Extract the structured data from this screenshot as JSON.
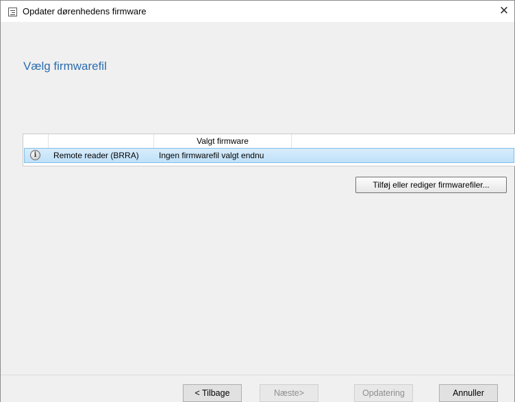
{
  "window": {
    "title": "Opdater dørenhedens firmware",
    "close_symbol": "✕"
  },
  "heading": "Vælg firmwarefil",
  "list": {
    "columns": [
      "",
      "",
      "Valgt firmware",
      ""
    ],
    "rows": [
      {
        "icon": "info-icon",
        "icon_glyph": "i",
        "device": "Remote reader (BRRA)",
        "firmware": "Ingen firmwarefil valgt endnu",
        "selected": true
      }
    ]
  },
  "add_edit_button": "Tilføj eller rediger firmwarefiler...",
  "footer": {
    "back": "< Tilbage",
    "next": "Næste>",
    "update": "Opdatering",
    "cancel": "Annuller"
  },
  "colors": {
    "heading": "#2b6cae",
    "selection": "#bfe1f9"
  }
}
